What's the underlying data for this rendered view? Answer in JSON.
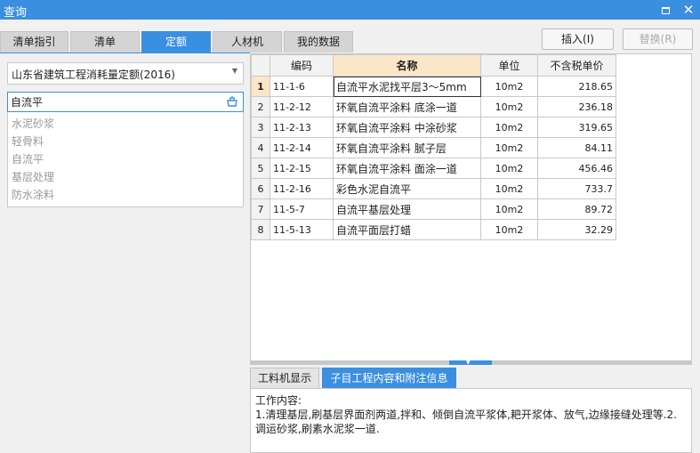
{
  "window": {
    "title": "查询"
  },
  "tabs": [
    {
      "label": "清单指引",
      "active": false
    },
    {
      "label": "清单",
      "active": false
    },
    {
      "label": "定额",
      "active": true
    },
    {
      "label": "人材机",
      "active": false
    },
    {
      "label": "我的数据",
      "active": false
    }
  ],
  "actions": {
    "insert_label": "插入(I)",
    "replace_label": "替换(R)"
  },
  "left": {
    "quota_select": "山东省建筑工程消耗量定额(2016)",
    "search_value": "自流平",
    "suggestions": [
      "水泥砂浆",
      "轻骨料",
      "自流平",
      "基层处理",
      "防水涂料"
    ]
  },
  "table": {
    "headers": {
      "code": "编码",
      "name": "名称",
      "unit": "单位",
      "price": "不含税单价"
    },
    "rows": [
      {
        "num": "1",
        "code": "11-1-6",
        "name": "自流平水泥找平层3～5mm",
        "unit": "10m2",
        "price": "218.65",
        "selected": true
      },
      {
        "num": "2",
        "code": "11-2-12",
        "name": "环氧自流平涂料 底涂一道",
        "unit": "10m2",
        "price": "236.18"
      },
      {
        "num": "3",
        "code": "11-2-13",
        "name": "环氧自流平涂料 中涂砂浆",
        "unit": "10m2",
        "price": "319.65"
      },
      {
        "num": "4",
        "code": "11-2-14",
        "name": "环氧自流平涂料 腻子层",
        "unit": "10m2",
        "price": "84.11"
      },
      {
        "num": "5",
        "code": "11-2-15",
        "name": "环氧自流平涂料 面涂一道",
        "unit": "10m2",
        "price": "456.46"
      },
      {
        "num": "6",
        "code": "11-2-16",
        "name": "彩色水泥自流平",
        "unit": "10m2",
        "price": "733.7"
      },
      {
        "num": "7",
        "code": "11-5-7",
        "name": "自流平基层处理",
        "unit": "10m2",
        "price": "89.72"
      },
      {
        "num": "8",
        "code": "11-5-13",
        "name": "自流平面层打蜡",
        "unit": "10m2",
        "price": "32.29"
      }
    ]
  },
  "bottom": {
    "tabs": [
      "工料机显示",
      "子目工程内容和附注信息"
    ],
    "active_tab": 1,
    "content_title": "工作内容:",
    "content_text": "1.清理基层,刷基层界面剂两道,拌和、倾倒自流平浆体,耙开浆体、放气,边缘接缝处理等.2.调运砂浆,刷素水泥浆一道."
  },
  "icons": {
    "maximize": "maximize-icon",
    "close": "close-icon",
    "search": "search-icon",
    "dropdown": "chevron-down-icon"
  },
  "colors": {
    "accent": "#3b8fe0",
    "header_highlight": "#fbe6c8"
  }
}
